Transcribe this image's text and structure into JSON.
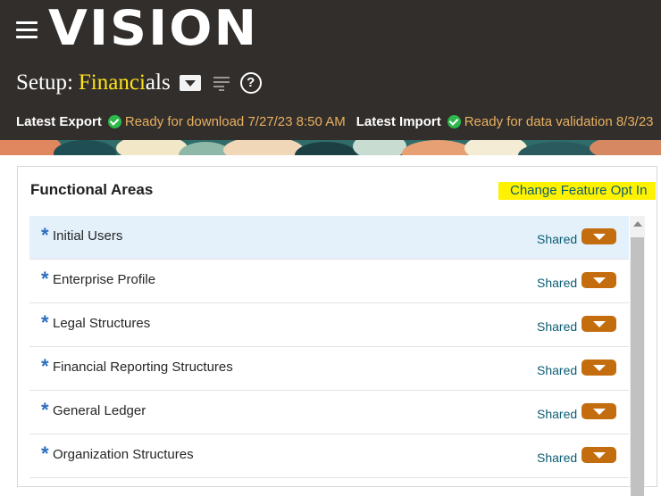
{
  "header": {
    "logo": "VISION",
    "title_prefix": "Setup:",
    "title_name_highlight": "Financi",
    "title_name_rest": "als",
    "latest_export": {
      "label": "Latest Export",
      "status": "Ready for download 7/27/23 8:50 AM"
    },
    "latest_import": {
      "label": "Latest Import",
      "status": "Ready for data validation 8/3/23"
    },
    "icons": {
      "menu": "hamburger-icon",
      "title_dropdown": "chevron-down-icon",
      "tasks": "tasks-icon",
      "help": "help-icon"
    }
  },
  "panel": {
    "title": "Functional Areas",
    "change_link": "Change Feature Opt In",
    "rows": [
      {
        "required": "*",
        "label": "Initial Users",
        "shared": "Shared"
      },
      {
        "required": "*",
        "label": "Enterprise Profile",
        "shared": "Shared"
      },
      {
        "required": "*",
        "label": "Legal Structures",
        "shared": "Shared"
      },
      {
        "required": "*",
        "label": "Financial Reporting Structures",
        "shared": "Shared"
      },
      {
        "required": "*",
        "label": "General Ledger",
        "shared": "Shared"
      },
      {
        "required": "*",
        "label": "Organization Structures",
        "shared": "Shared"
      }
    ]
  },
  "colors": {
    "header_bg": "#322e2b",
    "title_highlight": "#ffe21a",
    "status_text": "#e8b061",
    "check": "#2db84b",
    "link": "#0b5d74",
    "link_highlight": "#fff200",
    "row_selected": "#e4f1fb",
    "dropdown_button": "#c46d0e"
  }
}
